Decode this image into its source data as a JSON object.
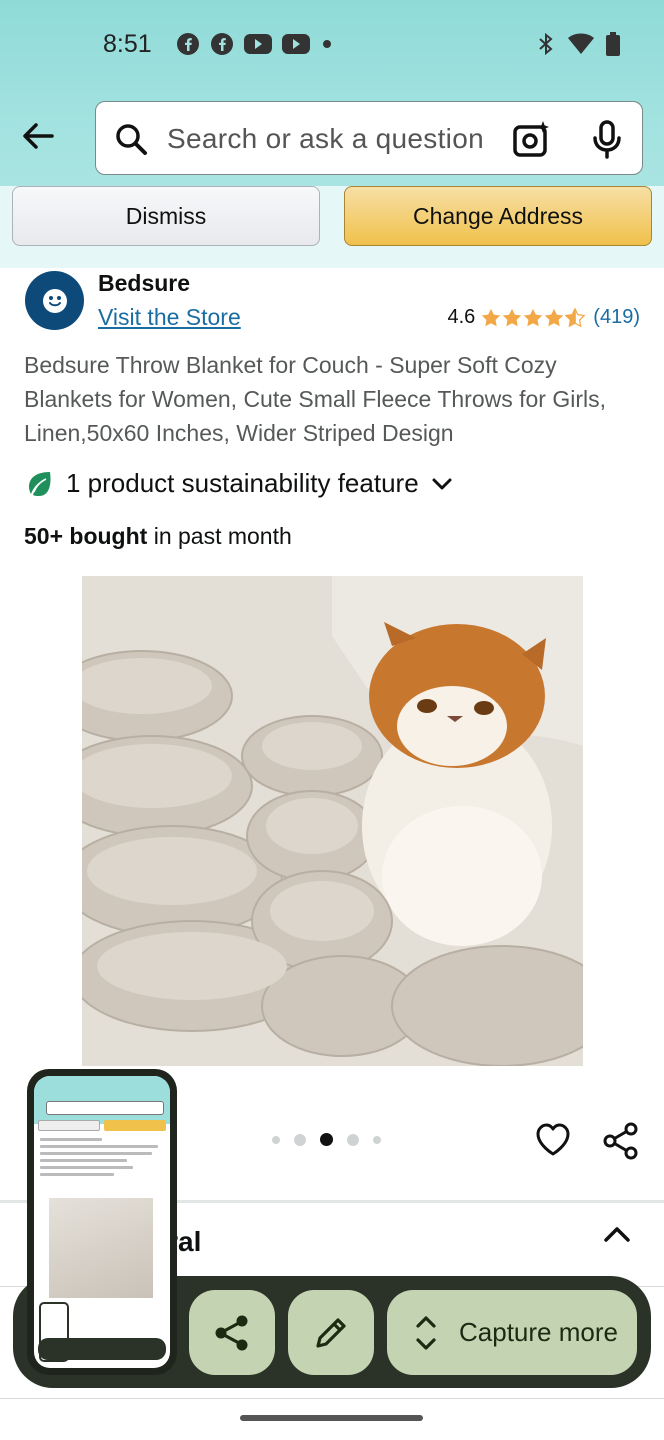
{
  "status_bar": {
    "time": "8:51",
    "left_icons": [
      "facebook-icon",
      "facebook-icon",
      "youtube-icon",
      "youtube-icon",
      "dot-icon"
    ],
    "right_icons": [
      "bluetooth-icon",
      "wifi-icon",
      "battery-icon"
    ]
  },
  "search": {
    "placeholder": "Search or ask a question"
  },
  "banner": {
    "dismiss_label": "Dismiss",
    "change_address_label": "Change Address"
  },
  "brand": {
    "name": "Bedsure",
    "store_link": "Visit the Store",
    "rating": "4.6",
    "rating_count": "(419)"
  },
  "product": {
    "title": "Bedsure Throw Blanket for Couch - Super Soft Cozy Blankets for Women, Cute Small Fleece Throws for Girls, Linen,50x60 Inches, Wider Striped Design",
    "sustainability": "1 product sustainability feature",
    "bought_bold": "50+ bought",
    "bought_rest": " in past month",
    "image_count": 5,
    "active_image": 3
  },
  "section": {
    "title_partial": "ural"
  },
  "capture": {
    "more_label": "Capture more"
  },
  "colors": {
    "header": "#a1e2df",
    "change_address": "#f0c14b",
    "link": "#1a6da3",
    "star": "#f3a847",
    "capture_bar": "#2b3328",
    "capture_button": "#c4d4b2"
  }
}
